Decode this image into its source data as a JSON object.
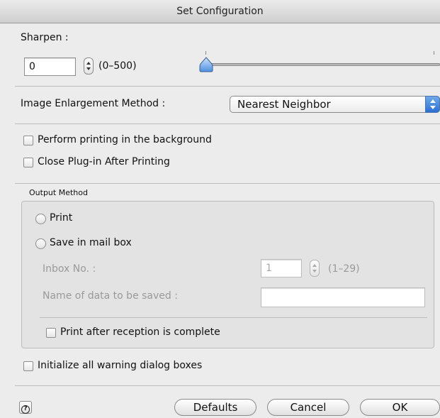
{
  "window": {
    "title": "Set Configuration"
  },
  "sharpen": {
    "label": "Sharpen :",
    "value": "0",
    "range": "(0–500)",
    "slider_level": 0
  },
  "enlargement": {
    "label": "Image Enlargement Method :",
    "selected": "Nearest Neighbor"
  },
  "options": {
    "background_print": {
      "label": "Perform printing in the background",
      "checked": false
    },
    "close_plugin": {
      "label": "Close Plug-in After Printing",
      "checked": false
    }
  },
  "output": {
    "group_label": "Output Method",
    "print_label": "Print",
    "mailbox_label": "Save in mail box",
    "inbox_label": "Inbox No. :",
    "inbox_value": "1",
    "inbox_range": "(1–29)",
    "data_name_label": "Name of data to be saved :",
    "data_name_value": "",
    "print_after_label": "Print after reception is complete"
  },
  "init_warnings": {
    "label": "Initialize all warning dialog boxes",
    "checked": false
  },
  "footer": {
    "help_glyph": "?",
    "defaults_label": "Defaults",
    "cancel_label": "Cancel",
    "ok_label": "OK"
  },
  "colors": {
    "accent": "#2b6fd3",
    "background": "#ececec"
  }
}
